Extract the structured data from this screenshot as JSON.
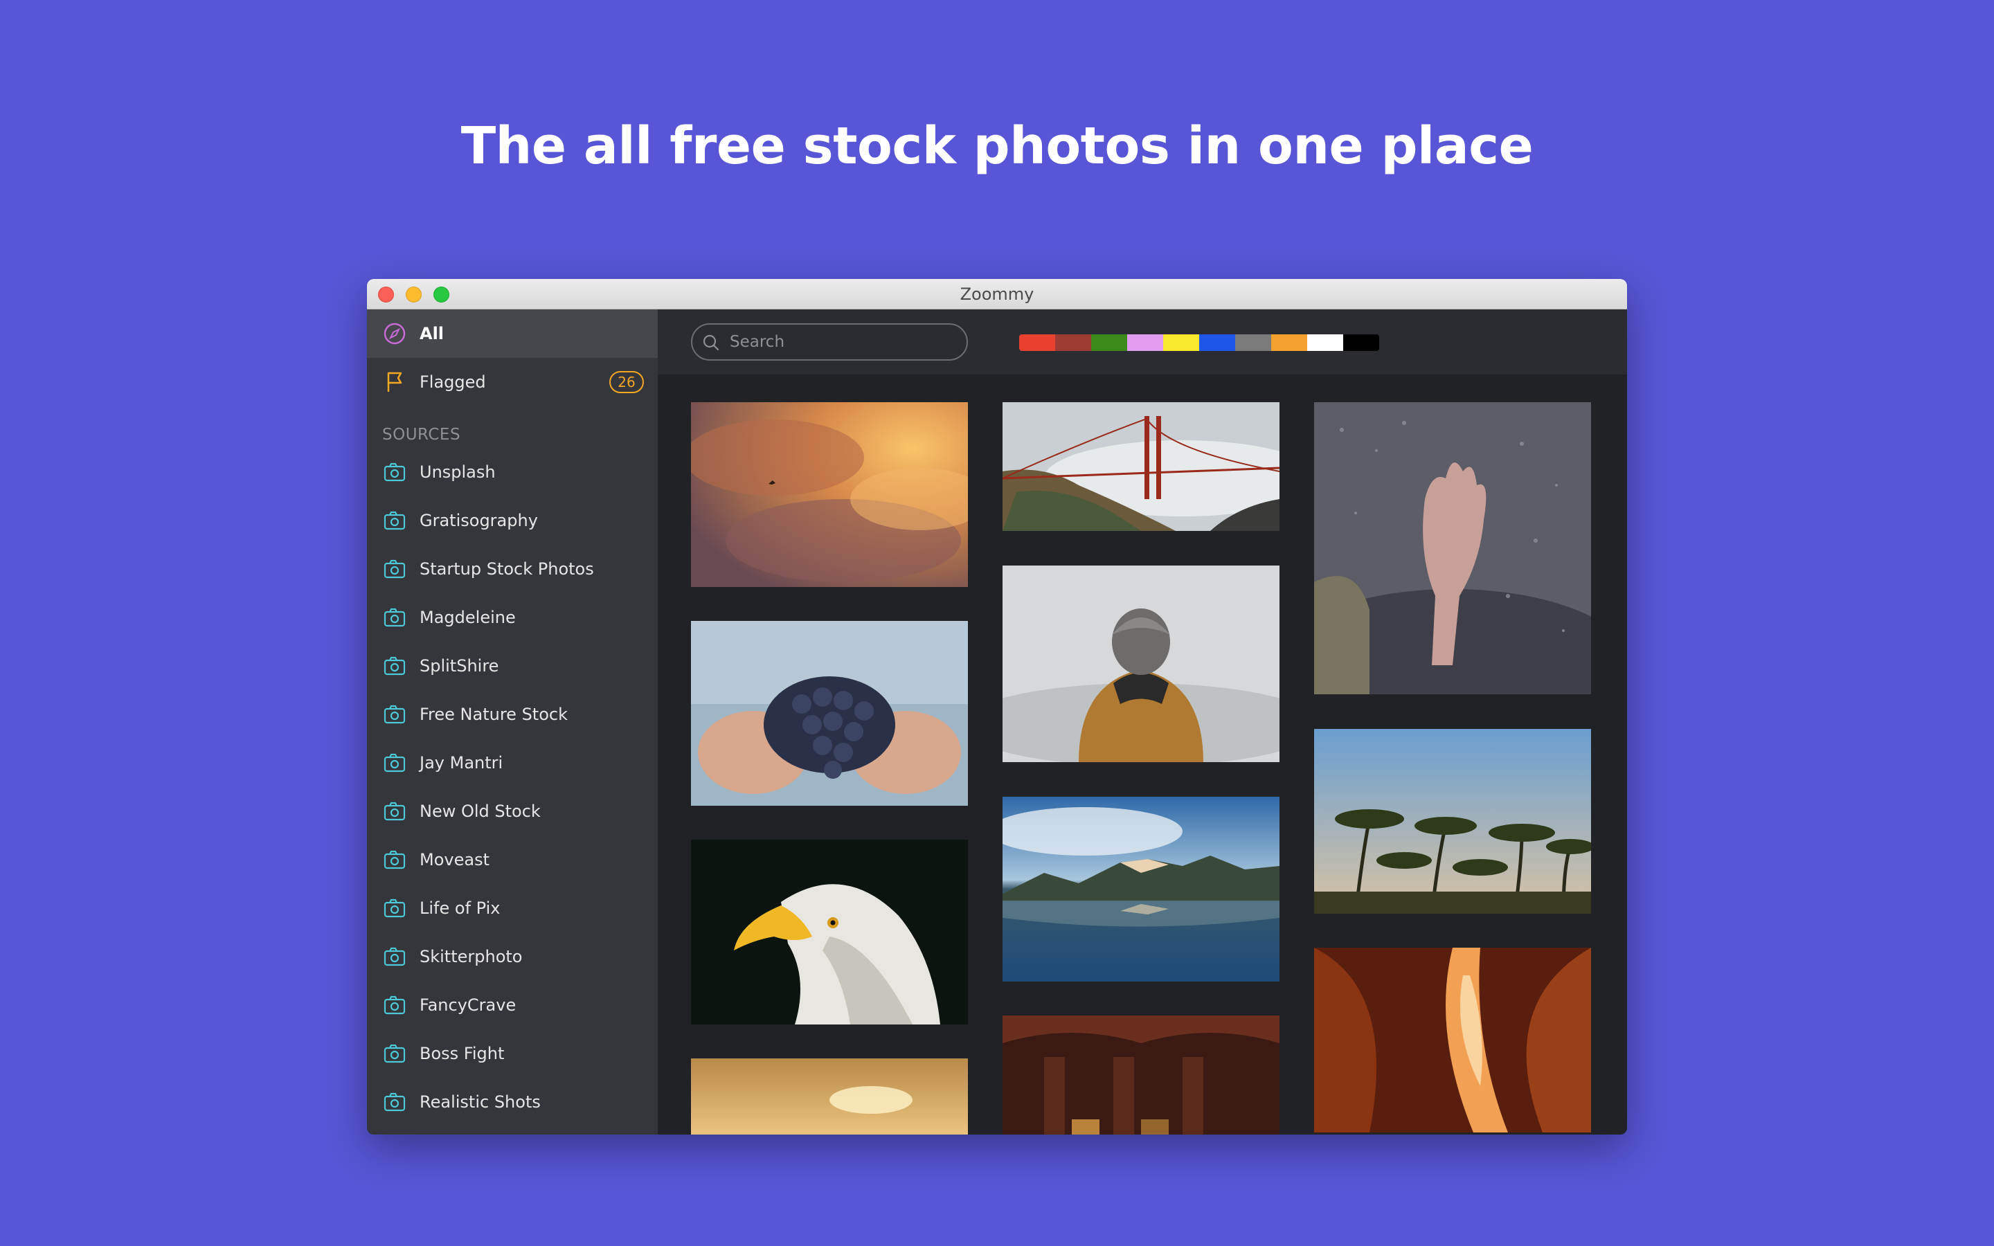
{
  "headline": "The all free stock photos in one place",
  "window": {
    "title": "Zoommy"
  },
  "sidebar": {
    "all_label": "All",
    "flagged_label": "Flagged",
    "flagged_count": "26",
    "sources_header": "SOURCES",
    "sources": [
      "Unsplash",
      "Gratisography",
      "Startup Stock Photos",
      "Magdeleine",
      "SplitShire",
      "Free Nature Stock",
      "Jay Mantri",
      "New Old Stock",
      "Moveast",
      "Life of Pix",
      "Skitterphoto",
      "FancyCrave",
      "Boss Fight",
      "Realistic Shots"
    ]
  },
  "search": {
    "placeholder": "Search"
  },
  "palette": [
    "#e8412f",
    "#9e3b32",
    "#3c8a1c",
    "#e19ef0",
    "#f8e72c",
    "#1e56e8",
    "#7b7b7b",
    "#f5a12d",
    "#ffffff",
    "#000000"
  ],
  "colors": {
    "accent_all": "#c86ad6",
    "accent_flag": "#f5a623",
    "source_icon": "#4cc8d6"
  }
}
